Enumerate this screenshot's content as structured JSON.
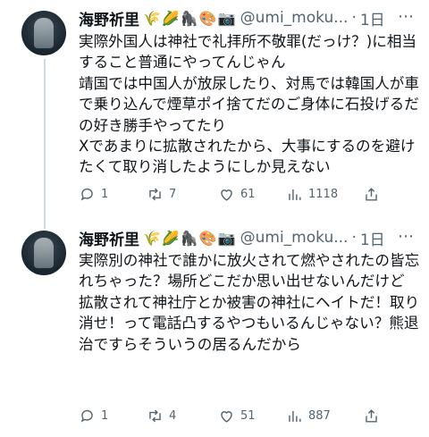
{
  "tweets": [
    {
      "name": "海野祈里",
      "name_emojis": "🌾🌽🦍🎨📷",
      "handle": "@umi_moku...",
      "dot": "·",
      "time": "1日",
      "body": "実際外国人は神社で礼拝所不敬罪(だっけ？)に相当すること普通にやってんじゃん\n靖国では中国人が放尿したり、対馬では韓国人が車で乗り込んで煙草ポイ捨てだのご身体に石投げるだの好き勝手やってたり\nXであまりに拡散されたから、大事にするのを避けたくて取り消したようにしか見えない",
      "replies": "1",
      "reposts": "7",
      "likes": "61",
      "views": "1118"
    },
    {
      "name": "海野祈里",
      "name_emojis": "🌾🌽🦍🎨📷",
      "handle": "@umi_moku...",
      "dot": "·",
      "time": "1日",
      "body": "実際別の神社で誰かに放火されて燃やされたの皆忘れちゃった？場所どこだか思い出せないんだけど\n拡散されて神社庁とか被害の神社にヘイトだ！取り消せ！って電話凸するやつもいるんじゃない？熊退治ですらそういうの居るんだから",
      "replies": "1",
      "reposts": "4",
      "likes": "51",
      "views": "887"
    }
  ]
}
